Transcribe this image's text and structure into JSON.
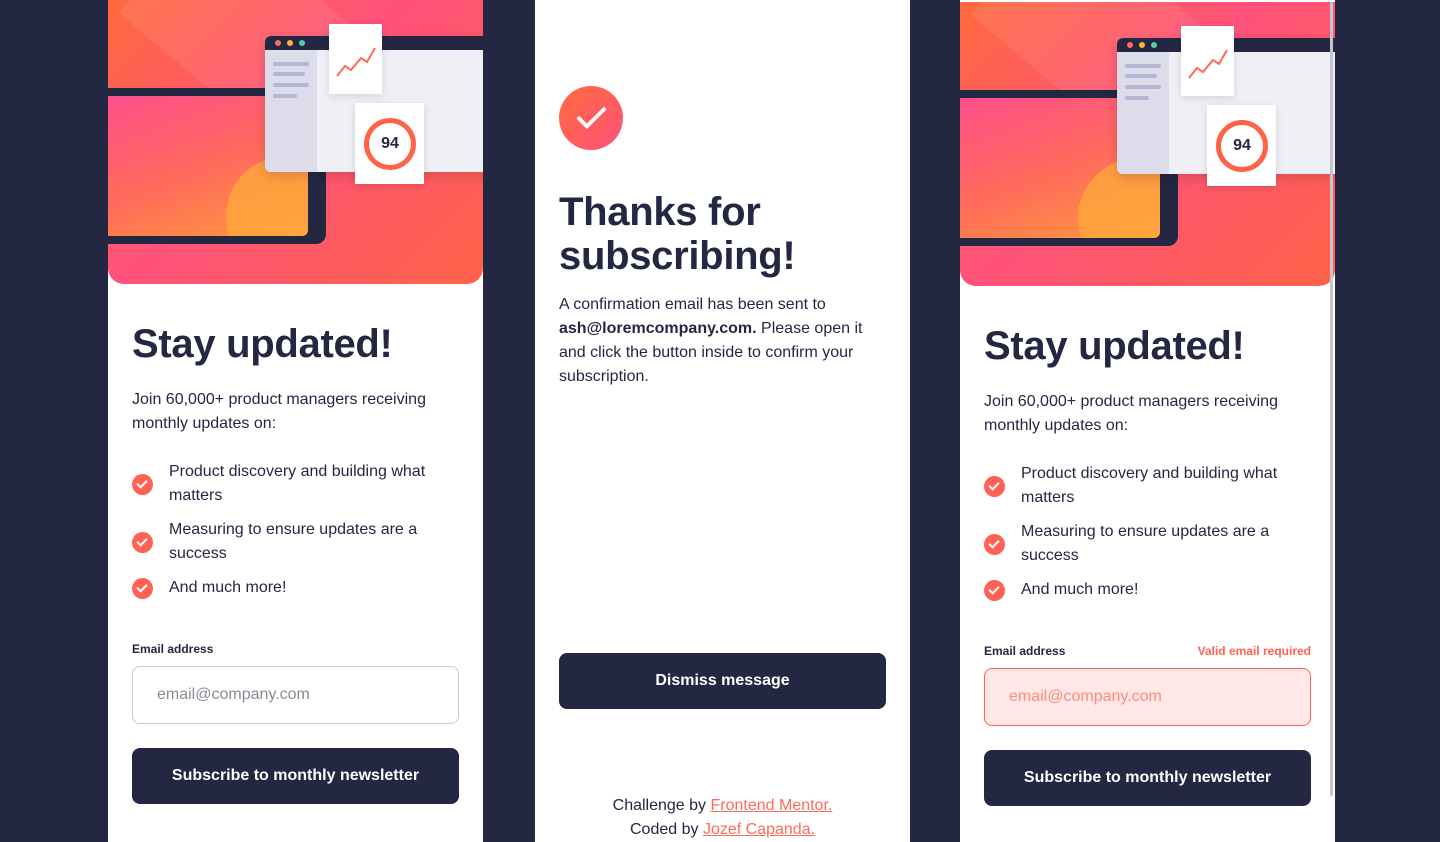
{
  "signup": {
    "score": "94",
    "title": "Stay updated!",
    "intro": "Join 60,000+ product managers receiving monthly updates on:",
    "features": [
      "Product discovery and building what matters",
      "Measuring to ensure updates are a success",
      "And much more!"
    ],
    "email_label": "Email address",
    "email_placeholder": "email@company.com",
    "submit_label": "Subscribe to monthly newsletter",
    "error_message": "Valid email required"
  },
  "success": {
    "title": "Thanks for subscribing!",
    "message_prefix": "A confirmation email has been sent to",
    "email": "ash@loremcompany.com.",
    "message_suffix": "Please open it and click the button inside to confirm your subscription.",
    "dismiss_label": "Dismiss message"
  },
  "attribution": {
    "challenge_prefix": "Challenge by",
    "challenge_link": "Frontend Mentor.",
    "coded_prefix": "Coded by",
    "coded_link": "Jozef Capanda."
  },
  "colors": {
    "background": "#242742",
    "accent": "#ff6155",
    "error_background": "#ffe8e6"
  },
  "icons": [
    "check-icon",
    "success-check-icon"
  ]
}
